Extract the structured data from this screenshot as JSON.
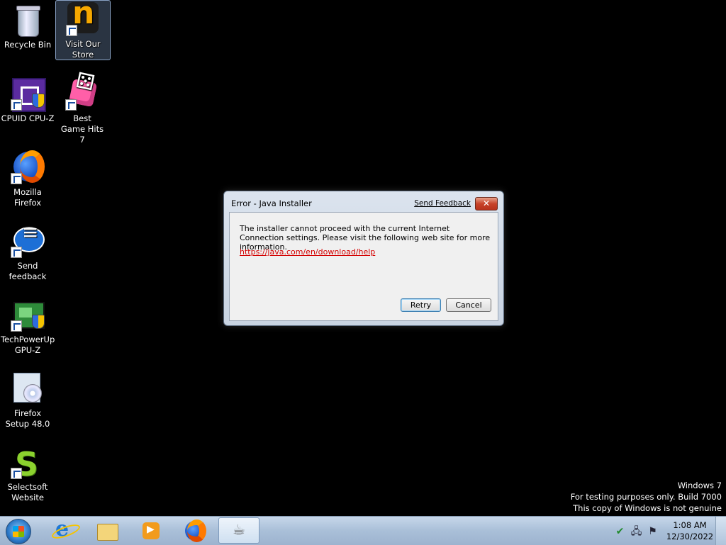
{
  "desktop": {
    "icons": [
      {
        "label": "Recycle Bin"
      },
      {
        "label": "Visit Our Store"
      },
      {
        "label": "CPUID CPU-Z"
      },
      {
        "label": "Best Game Hits 7"
      },
      {
        "label": "Mozilla Firefox"
      },
      {
        "label": "Send feedback"
      },
      {
        "label": "TechPowerUp GPU-Z"
      },
      {
        "label": "Firefox Setup 48.0"
      },
      {
        "label": "Selectsoft Website"
      }
    ]
  },
  "dialog": {
    "title": "Error - Java Installer",
    "feedback_link": "Send Feedback",
    "close_glyph": "✕",
    "message": "The installer cannot proceed with the current Internet Connection settings. Please visit the following web site for more information.",
    "url": "https://java.com/en/download/help",
    "retry_label": "Retry",
    "cancel_label": "Cancel"
  },
  "watermark": {
    "line1": "Windows 7",
    "line2": "For testing purposes only. Build 7000",
    "line3": "This copy of Windows is not genuine"
  },
  "taskbar": {
    "buttons": [
      "start-orb",
      "internet-explorer",
      "windows-explorer",
      "windows-media-player",
      "firefox",
      "java-installer"
    ],
    "active_button": "java-installer",
    "tray_icons": [
      "security-shield-icon",
      "network-icon",
      "action-center-flag-icon"
    ],
    "clock_time": "1:08 AM",
    "clock_date": "12/30/2022"
  }
}
